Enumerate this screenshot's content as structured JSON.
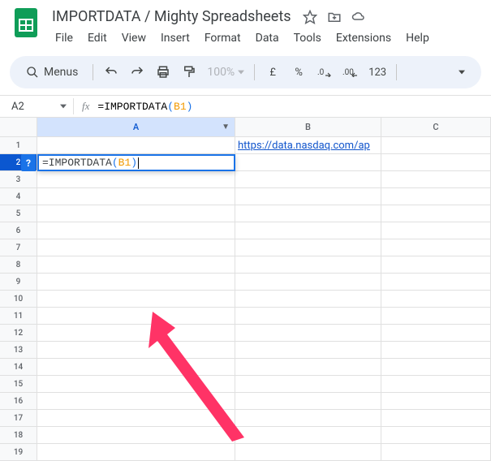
{
  "doc_title": "IMPORTDATA  / Mighty Spreadsheets",
  "menus_label": "Menus",
  "menubar": [
    "File",
    "Edit",
    "View",
    "Insert",
    "Format",
    "Data",
    "Tools",
    "Extensions",
    "Help"
  ],
  "zoom": "100%",
  "currency": "£",
  "percent": "%",
  "num123": "123",
  "name_box": "A2",
  "fx_label": "fx",
  "formula_prefix": "=IMPORTDATA",
  "formula_open": "(",
  "formula_ref": "B1",
  "formula_close": ")",
  "col_headers": {
    "a": "A",
    "b": "B",
    "c": "C"
  },
  "row_numbers": [
    "1",
    "2",
    "3",
    "4",
    "5",
    "6",
    "7",
    "8",
    "9",
    "10",
    "11",
    "12",
    "13",
    "14",
    "15",
    "16",
    "17",
    "18",
    "19"
  ],
  "active_row_index": 1,
  "cell_b1": "https://data.nasdaq.com/ap",
  "active_cell_formula_prefix": "=IMPORTDATA",
  "active_cell_formula_open": "(",
  "active_cell_formula_ref": "B1",
  "active_cell_formula_close": ")",
  "hint": "?"
}
